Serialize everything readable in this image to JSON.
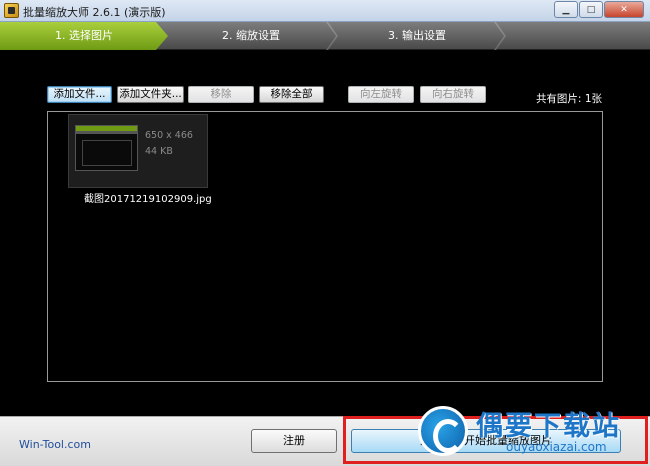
{
  "window": {
    "title": "批量缩放大师 2.6.1 (演示版)"
  },
  "steps": [
    {
      "label": "1. 选择图片",
      "active": true
    },
    {
      "label": "2. 缩放设置",
      "active": false
    },
    {
      "label": "3. 输出设置",
      "active": false
    }
  ],
  "toolbar": {
    "add_files": "添加文件...",
    "add_folder": "添加文件夹...",
    "remove": "移除",
    "remove_all": "移除全部",
    "rotate_left": "向左旋转",
    "rotate_right": "向右旋转"
  },
  "image_count": "共有图片: 1张",
  "images": [
    {
      "dimensions": "650 x 466",
      "size": "44 KB",
      "filename": "截图20171219102909.jpg"
    }
  ],
  "footer": {
    "brand": "Win-Tool.com",
    "register": "注册",
    "start": "点击这里开始批量缩放图片"
  },
  "watermark": {
    "title": "偶要下载站",
    "url": "ouyaoxiazai.com"
  },
  "colors": {
    "step_active": "#8cbf1f",
    "highlight_box": "#e01f1f",
    "brand_link": "#1f4e9b"
  }
}
